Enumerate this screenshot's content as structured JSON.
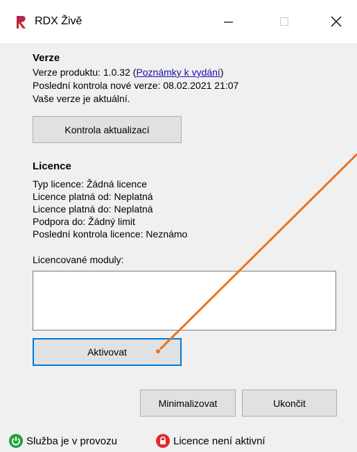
{
  "window": {
    "title": "RDX Živě",
    "icon": "rdx-logo-icon"
  },
  "version": {
    "heading": "Verze",
    "product_version_label": "Verze produktu: 1.0.32 (",
    "release_notes_link": "Poznámky k vydání",
    "product_version_close": ")",
    "last_check": "Poslední kontrola nové verze: 08.02.2021 21:07",
    "status": "Vaše verze je aktuální.",
    "check_button": "Kontrola aktualizací"
  },
  "license": {
    "heading": "Licence",
    "type": "Typ licence: Žádná licence",
    "valid_from": "Licence platná od: Neplatná",
    "valid_to": "Licence platná do: Neplatná",
    "support_to": "Podpora do: Žádný limit",
    "last_check": "Poslední kontrola licence: Neznámo",
    "modules_label": "Licencované moduly:",
    "modules": [],
    "activate_button": "Aktivovat"
  },
  "actions": {
    "minimize_button": "Minimalizovat",
    "exit_button": "Ukončit"
  },
  "statusbar": {
    "service": {
      "text": "Služba je v provozu",
      "icon": "power-icon",
      "color": "#1fa23a"
    },
    "license": {
      "text": "Licence není aktivní",
      "icon": "lock-icon",
      "color": "#e02a2a"
    }
  },
  "colors": {
    "annotation_arrow": "#e8731e",
    "focus_border": "#0078d7"
  }
}
